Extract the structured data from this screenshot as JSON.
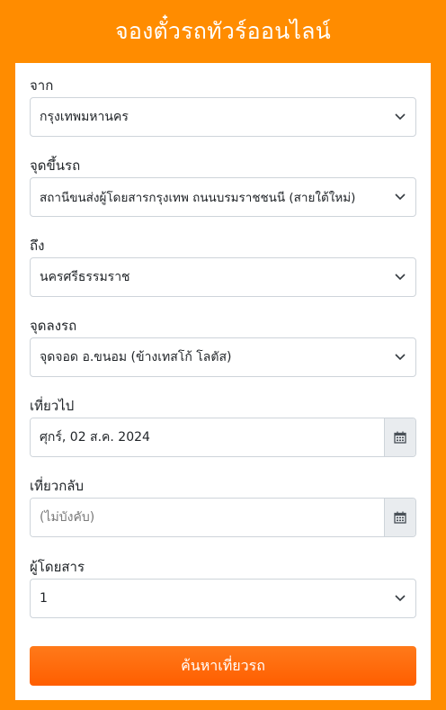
{
  "header": {
    "title": "จองตั๋วรถทัวร์ออนไลน์"
  },
  "form": {
    "from": {
      "label": "จาก",
      "value": "กรุงเทพมหานคร"
    },
    "pickup": {
      "label": "จุดขึ้นรถ",
      "value": "สถานีขนส่งผู้โดยสารกรุงเทพ ถนนบรมราชชนนี (สายใต้ใหม่)"
    },
    "to": {
      "label": "ถึง",
      "value": "นครศรีธรรมราช"
    },
    "dropoff": {
      "label": "จุดลงรถ",
      "value": "จุดจอด อ.ขนอม (ข้างเทสโก้ โลตัส)"
    },
    "depart": {
      "label": "เที่ยวไป",
      "value": "ศุกร์, 02 ส.ค. 2024"
    },
    "return": {
      "label": "เที่ยวกลับ",
      "placeholder": "(ไม่บังคับ)"
    },
    "passengers": {
      "label": "ผู้โดยสาร",
      "value": "1"
    },
    "search_label": "ค้นหาเที่ยวรถ"
  },
  "icons": {
    "chevron": "chevron-down-icon",
    "calendar": "calendar-icon"
  },
  "colors": {
    "background": "#ff8c00",
    "button": "#ff6a00"
  }
}
